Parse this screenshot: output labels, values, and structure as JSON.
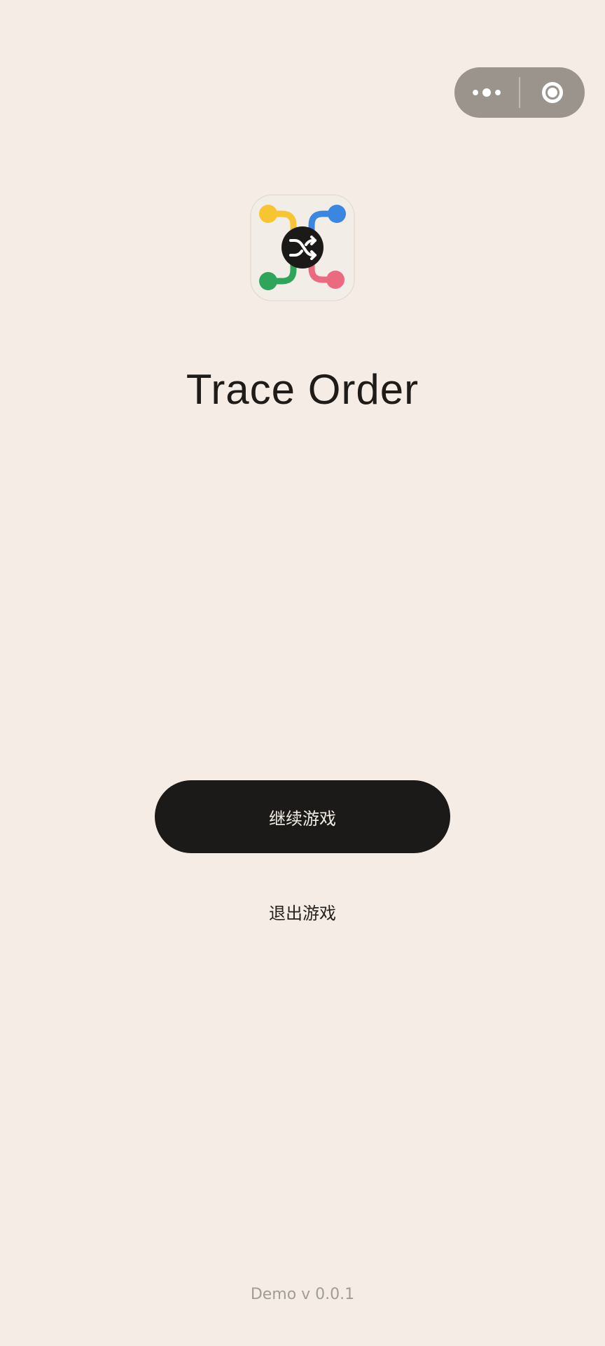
{
  "capsule": {
    "more_icon": "more-dots-icon",
    "close_icon": "target-circle-icon"
  },
  "app_icon": {
    "icon": "shuffle-icon",
    "colors": {
      "yellow": "#f7c531",
      "blue": "#3a86e0",
      "green": "#2ea55b",
      "pink": "#ec6a80",
      "center": "#1c1a19"
    }
  },
  "title": "Trace Order",
  "buttons": {
    "continue_label": "继续游戏",
    "exit_label": "退出游戏"
  },
  "footer": {
    "version": "Demo v 0.0.1"
  },
  "colors": {
    "background": "#f5ede5",
    "primary_button": "#1c1a19",
    "capsule": "#9b948d"
  }
}
